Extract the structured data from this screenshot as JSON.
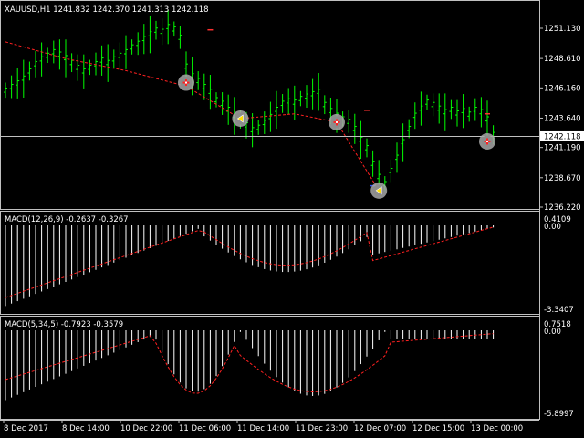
{
  "main_pane": {
    "header": "XAUUSD,H1  1241.832 1242.370 1241.313 1242.118",
    "price_ticks": [
      "1251.130",
      "1248.610",
      "1246.160",
      "1243.640",
      "1241.190",
      "1238.670",
      "1236.220"
    ],
    "current_price": "1242.118",
    "current_price_value": 1242.118,
    "bull_color": "#00ff00",
    "ma_color": "#ff2020",
    "markers": [
      {
        "kind": "buy",
        "icon": "plus-circle-icon",
        "bar": 30,
        "price": 1246.6
      },
      {
        "kind": "arrow",
        "icon": "left-arrow-icon",
        "bar": 39,
        "price": 1243.6
      },
      {
        "kind": "buy",
        "icon": "plus-circle-icon",
        "bar": 55,
        "price": 1243.3
      },
      {
        "kind": "arrow",
        "icon": "left-arrow-icon",
        "bar": 62,
        "price": 1237.6
      },
      {
        "kind": "buy",
        "icon": "plus-circle-icon",
        "bar": 80,
        "price": 1241.7
      }
    ]
  },
  "macd1": {
    "title": "MACD(12,26,9) -0.2637 -0.3267",
    "ticks": [
      "0.4109",
      "0.00",
      "-3.3407"
    ]
  },
  "macd2": {
    "title": "MACD(5,34,5) -0.7923 -0.3579",
    "ticks": [
      "0.7518",
      "0.00",
      "-5.8997"
    ]
  },
  "time_axis": {
    "labels": [
      "8 Dec 2017",
      "8 Dec 14:00",
      "10 Dec 22:00",
      "11 Dec 06:00",
      "11 Dec 14:00",
      "11 Dec 23:00",
      "12 Dec 07:00",
      "12 Dec 15:00",
      "13 Dec 00:00"
    ]
  }
}
